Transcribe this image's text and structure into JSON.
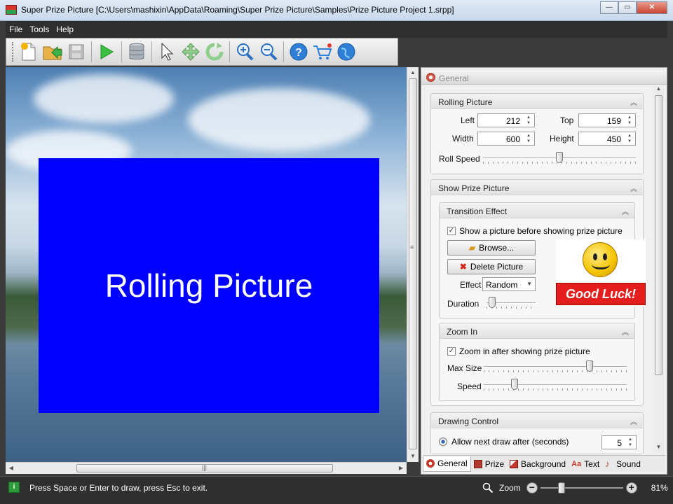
{
  "window": {
    "title": "Super Prize Picture [C:\\Users\\mashixin\\AppData\\Roaming\\Super Prize Picture\\Samples\\Prize Picture Project 1.srpp]",
    "minimize": "—",
    "maximize": "▭",
    "close": "✕"
  },
  "menu": {
    "items": [
      "File",
      "Tools",
      "Help"
    ]
  },
  "toolbar": {
    "buttons": [
      {
        "name": "new-project",
        "icon": "new-document-icon"
      },
      {
        "name": "open-project",
        "icon": "open-folder-icon"
      },
      {
        "name": "save-project",
        "icon": "save-disk-icon"
      },
      {
        "name": "start-draw",
        "icon": "play-icon"
      },
      {
        "name": "database",
        "icon": "database-icon"
      },
      {
        "name": "select",
        "icon": "pointer-arrow-icon"
      },
      {
        "name": "move",
        "icon": "move-cross-icon"
      },
      {
        "name": "rotate",
        "icon": "rotate-icon"
      },
      {
        "name": "zoom-in",
        "icon": "zoom-in-icon"
      },
      {
        "name": "zoom-out",
        "icon": "zoom-out-icon"
      },
      {
        "name": "help",
        "icon": "help-icon"
      },
      {
        "name": "buy",
        "icon": "cart-icon"
      },
      {
        "name": "website",
        "icon": "globe-icon"
      }
    ]
  },
  "canvas": {
    "rolling_text": "Rolling Picture"
  },
  "panel": {
    "header": "General",
    "rolling_picture": {
      "title": "Rolling Picture",
      "left_label": "Left",
      "left_value": "212",
      "top_label": "Top",
      "top_value": "159",
      "width_label": "Width",
      "width_value": "600",
      "height_label": "Height",
      "height_value": "450",
      "roll_speed_label": "Roll Speed",
      "roll_speed": 0.5
    },
    "show_prize_picture": {
      "title": "Show Prize Picture",
      "transition": {
        "title": "Transition Effect",
        "show_before_label": "Show a picture before showing prize picture",
        "show_before_checked": "✓",
        "browse_label": "Browse...",
        "delete_label": "Delete Picture",
        "effect_label": "Effect",
        "effect_value": "Random",
        "duration_label": "Duration",
        "duration": 0.05,
        "preview_text": "Good Luck!"
      },
      "zoom_in": {
        "title": "Zoom In",
        "zoom_after_label": "Zoom in after showing prize picture",
        "zoom_after_checked": "✓",
        "max_size_label": "Max Size",
        "max_size": 0.75,
        "speed_label": "Speed",
        "speed": 0.2
      }
    },
    "drawing_control": {
      "title": "Drawing Control",
      "allow_next_label": "Allow next draw after (seconds)",
      "allow_next_value": "5"
    }
  },
  "tabs": [
    {
      "label": "General",
      "icon": "gear-icon",
      "color": "#c0392b"
    },
    {
      "label": "Prize",
      "icon": "book-icon",
      "color": "#b03a2e"
    },
    {
      "label": "Background",
      "icon": "picture-icon",
      "color": "#c0392b"
    },
    {
      "label": "Text",
      "icon": "text-icon",
      "color": "#c0392b"
    },
    {
      "label": "Sound",
      "icon": "music-note-icon",
      "color": "#c0392b"
    }
  ],
  "status": {
    "message": "Press Space or Enter to draw, press Esc to exit.",
    "zoom_label": "Zoom",
    "zoom_minus": "−",
    "zoom_plus": "+",
    "zoom_value": "81%",
    "zoom_level": 0.23
  },
  "colors": {
    "rolling_box": "#0000ff",
    "status_bg": "#2f2f2f",
    "accent_red": "#e41d1d"
  }
}
